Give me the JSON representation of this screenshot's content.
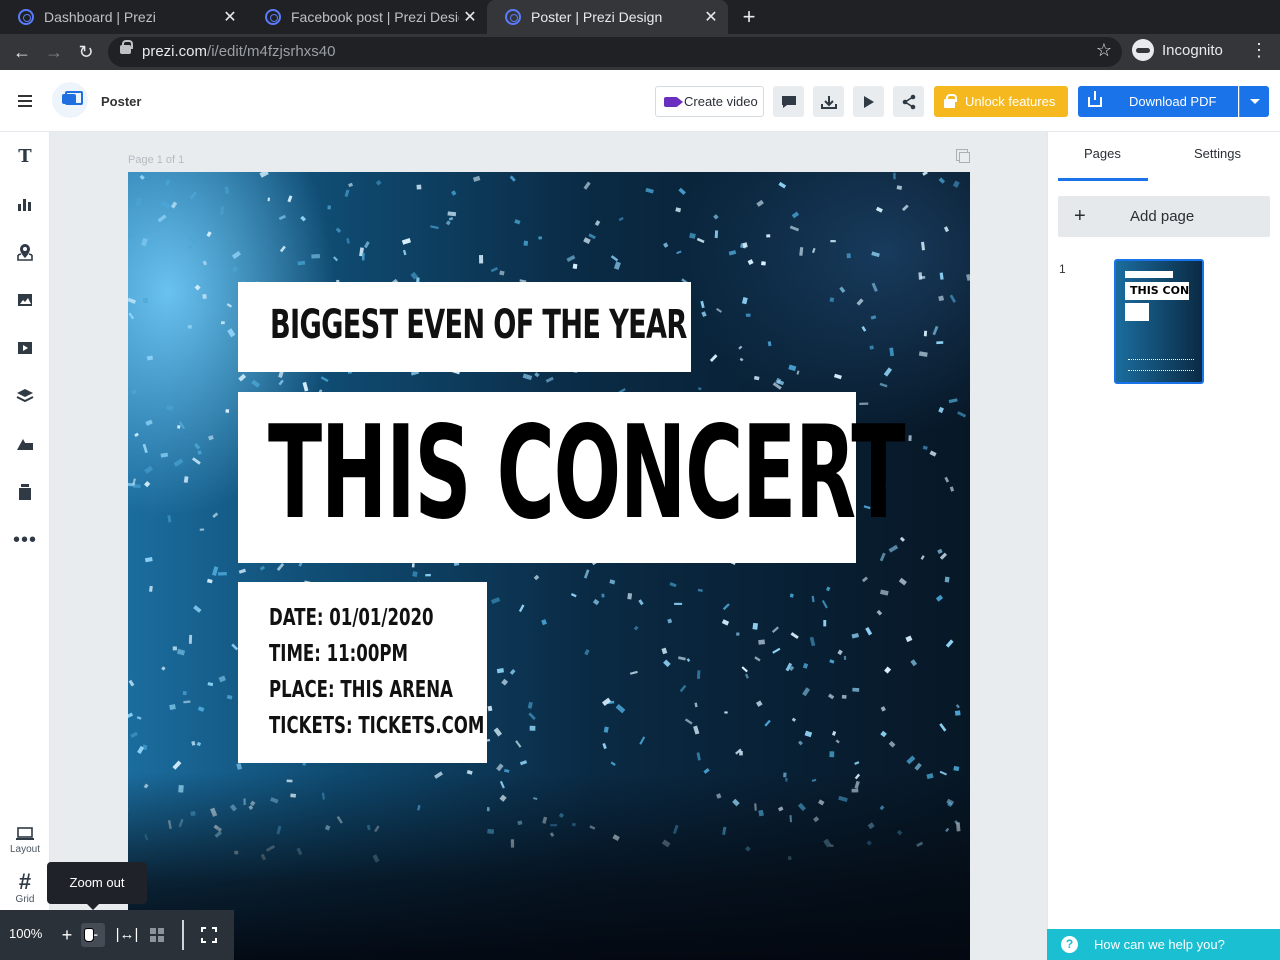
{
  "browser": {
    "tabs": [
      {
        "title": "Dashboard | Prezi",
        "active": false
      },
      {
        "title": "Facebook post | Prezi Design",
        "active": false
      },
      {
        "title": "Poster | Prezi Design",
        "active": true
      }
    ],
    "url_host": "prezi.com",
    "url_path": "/i/edit/m4fzjsrhxs40",
    "profile_label": "Incognito"
  },
  "header": {
    "doc_title": "Poster",
    "create_video_label": "Create video",
    "unlock_label": "Unlock features",
    "download_label": "Download PDF",
    "colors": {
      "unlock": "#f5b81f",
      "download": "#1a73e8",
      "video_icon": "#6b2fbf"
    }
  },
  "left_toolbar": {
    "tools": [
      "text-icon",
      "chart-icon",
      "map-icon",
      "image-icon",
      "video-icon",
      "layers-icon",
      "shapes-icon",
      "content-blocks-icon",
      "more-icon"
    ],
    "layout_label": "Layout",
    "grid_label": "Grid"
  },
  "canvas": {
    "page_label": "Page 1 of 1",
    "poster": {
      "subtitle": "BIGGEST EVEN OF THE YEAR",
      "title": "THIS CONCERT",
      "details": [
        "DATE: 01/01/2020",
        "TIME: 11:00PM",
        "PLACE: THIS ARENA",
        "TICKETS: TICKETS.COM"
      ]
    }
  },
  "right_panel": {
    "tabs": [
      "Pages",
      "Settings"
    ],
    "active_tab": "Pages",
    "add_page_label": "Add page",
    "pages": [
      {
        "number": "1",
        "thumb_title": "THIS CONCERT"
      }
    ]
  },
  "zoom": {
    "level": "100%",
    "tooltip": "Zoom out"
  },
  "help": {
    "label": "How can we help you?",
    "color": "#1bbfd2"
  }
}
